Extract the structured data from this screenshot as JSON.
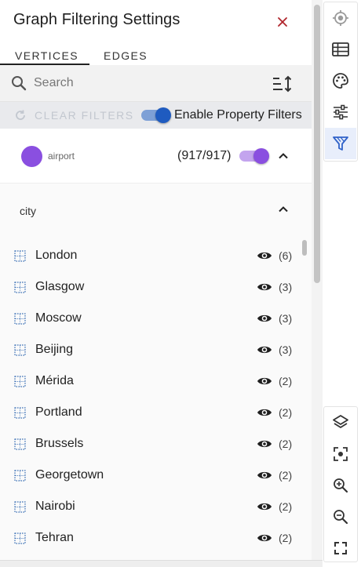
{
  "panel": {
    "title": "Graph Filtering Settings",
    "tabs": [
      {
        "label": "Vertices",
        "active": true
      },
      {
        "label": "Edges",
        "active": false
      }
    ],
    "search": {
      "placeholder": "Search",
      "value": ""
    },
    "filter_bar": {
      "clear_filters_label": "CLEAR FILTERS",
      "clear_filters_enabled": false,
      "property_filters_label": "Enable Property Filters",
      "property_filters_on": true
    },
    "vertex": {
      "label": "airport",
      "count": "(917/917)",
      "color": "#8a4fe0",
      "visible": true
    },
    "property": {
      "name": "city",
      "values": [
        {
          "label": "London",
          "count": "(6)"
        },
        {
          "label": "Glasgow",
          "count": "(3)"
        },
        {
          "label": "Moscow",
          "count": "(3)"
        },
        {
          "label": "Beijing",
          "count": "(3)"
        },
        {
          "label": "Mérida",
          "count": "(2)"
        },
        {
          "label": "Portland",
          "count": "(2)"
        },
        {
          "label": "Brussels",
          "count": "(2)"
        },
        {
          "label": "Georgetown",
          "count": "(2)"
        },
        {
          "label": "Nairobi",
          "count": "(2)"
        },
        {
          "label": "Tehran",
          "count": "(2)"
        }
      ]
    }
  },
  "toolbar": {
    "top": [
      {
        "icon": "locate-icon",
        "active": false
      },
      {
        "icon": "table-icon",
        "active": false
      },
      {
        "icon": "palette-icon",
        "active": false
      },
      {
        "icon": "sliders-icon",
        "active": false
      },
      {
        "icon": "filter-icon",
        "active": true
      }
    ],
    "bottom": [
      {
        "icon": "layers-icon"
      },
      {
        "icon": "focus-icon"
      },
      {
        "icon": "zoom-in-icon"
      },
      {
        "icon": "zoom-out-icon"
      },
      {
        "icon": "fullscreen-icon"
      }
    ]
  },
  "colors": {
    "accent": "#1f5bc0",
    "close": "#b0252b",
    "vertex": "#8a4fe0",
    "active_tool": "#2f62c9",
    "icon": "#333333",
    "value_icon": "#3a6fb5"
  }
}
